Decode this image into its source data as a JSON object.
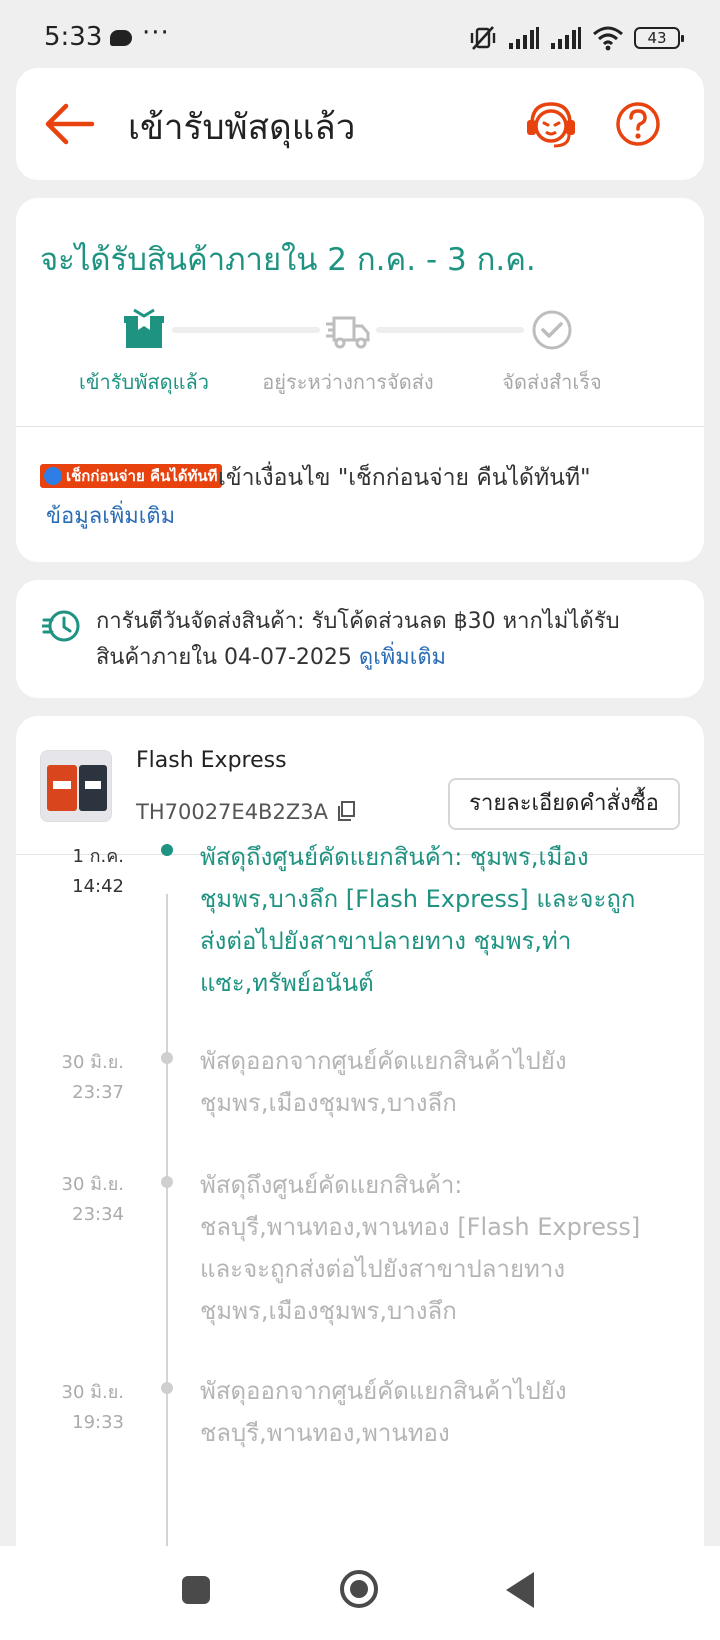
{
  "status_bar": {
    "time": "5:33",
    "dots": "···",
    "battery": "43",
    "icons": [
      "chat-icon",
      "mute-vibrate-icon",
      "signal-icon",
      "signal-icon",
      "wifi-icon",
      "battery-icon"
    ]
  },
  "header": {
    "title": "เข้ารับพัสดุแล้ว",
    "icons": [
      "back-arrow-icon",
      "support-agent-icon",
      "help-icon"
    ]
  },
  "delivery": {
    "eta": "จะได้รับสินค้าภายใน 2 ก.ค. - 3 ก.ค.",
    "steps": [
      {
        "label": "เข้ารับพัสดุแล้ว",
        "icon": "package-icon",
        "active": true
      },
      {
        "label": "อยู่ระหว่างการจัดส่ง",
        "icon": "truck-icon",
        "active": false
      },
      {
        "label": "จัดส่งสำเร็จ",
        "icon": "check-circle-icon",
        "active": false
      }
    ],
    "ccod_badge": "เช็กก่อนจ่าย คืนได้ทันที",
    "ccod_text": "เข้าเงื่อนไข \"เช็กก่อนจ่าย คืนได้ทันที\"",
    "more_info": "ข้อมูลเพิ่มเติม"
  },
  "guarantee": {
    "text": "การันตีวันจัดส่งสินค้า: รับโค้ดส่วนลด ฿30 หากไม่ได้รับสินค้าภายใน 04-07-2025",
    "link": "ดูเพิ่มเติม",
    "icon": "fast-clock-icon"
  },
  "shipment": {
    "carrier": "Flash Express",
    "tracking_number": "TH70027E4B2Z3A",
    "order_details_button": "รายละเอียดคำสั่งซื้อ"
  },
  "events": [
    {
      "date": "1 ก.ค.",
      "time": "14:42",
      "text": "พัสดุถึงศูนย์คัดแยกสินค้า: ชุมพร,เมืองชุมพร,บางลึก  [Flash Express] และจะถูกส่งต่อไปยังสาขาปลายทาง ชุมพร,ท่าแซะ,ทรัพย์อนันต์",
      "active": true
    },
    {
      "date": "30 มิ.ย.",
      "time": "23:37",
      "text": "พัสดุออกจากศูนย์คัดแยกสินค้าไปยัง ชุมพร,เมืองชุมพร,บางลึก",
      "active": false
    },
    {
      "date": "30 มิ.ย.",
      "time": "23:34",
      "text": "พัสดุถึงศูนย์คัดแยกสินค้า: ชลบุรี,พานทอง,พานทอง  [Flash Express] และจะถูกส่งต่อไปยังสาขาปลายทาง ชุมพร,เมืองชุมพร,บางลึก",
      "active": false
    },
    {
      "date": "30 มิ.ย.",
      "time": "19:33",
      "text": "พัสดุออกจากศูนย์คัดแยกสินค้าไปยัง ชลบุรี,พานทอง,พานทอง",
      "active": false
    }
  ],
  "colors": {
    "accent": "#1f9382",
    "brand_orange": "#e8430f",
    "link_blue": "#2b6db5",
    "inactive": "#b5b5b5"
  }
}
